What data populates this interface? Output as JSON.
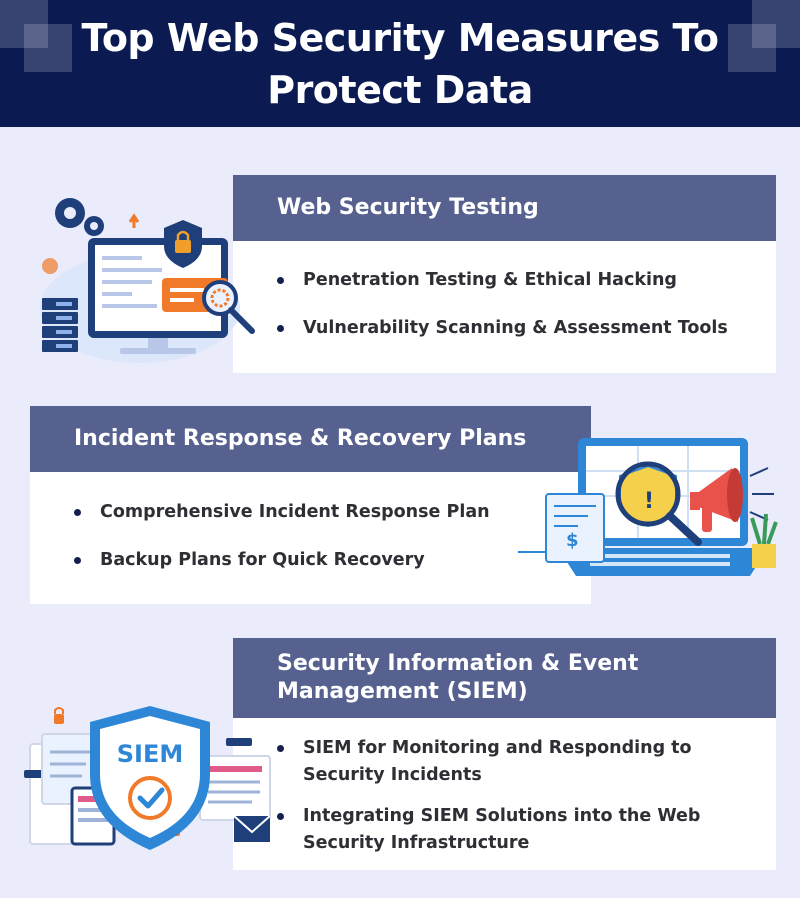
{
  "header": {
    "title": "Top Web Security Measures To Protect Data"
  },
  "sections": [
    {
      "heading": "Web Security Testing",
      "bullets": [
        "Penetration Testing & Ethical Hacking",
        "Vulnerability Scanning & Assessment Tools"
      ],
      "icon": "monitor-lock-magnifier-icon"
    },
    {
      "heading": "Incident Response & Recovery Plans",
      "bullets": [
        "Comprehensive Incident Response Plan",
        "Backup Plans for Quick Recovery"
      ],
      "icon": "laptop-warning-megaphone-icon"
    },
    {
      "heading": "Security Information & Event Management (SIEM)",
      "bullets": [
        "SIEM for Monitoring and Responding to Security Incidents",
        "Integrating SIEM Solutions into the Web Security Infrastructure"
      ],
      "icon": "siem-shield-icon",
      "badge": "SIEM"
    }
  ],
  "colors": {
    "header_bg": "#0c1a52",
    "page_bg": "#eaecfb",
    "card_heading_bg": "#56618f",
    "accent_orange": "#f07a2a",
    "accent_blue": "#2e86d6"
  }
}
